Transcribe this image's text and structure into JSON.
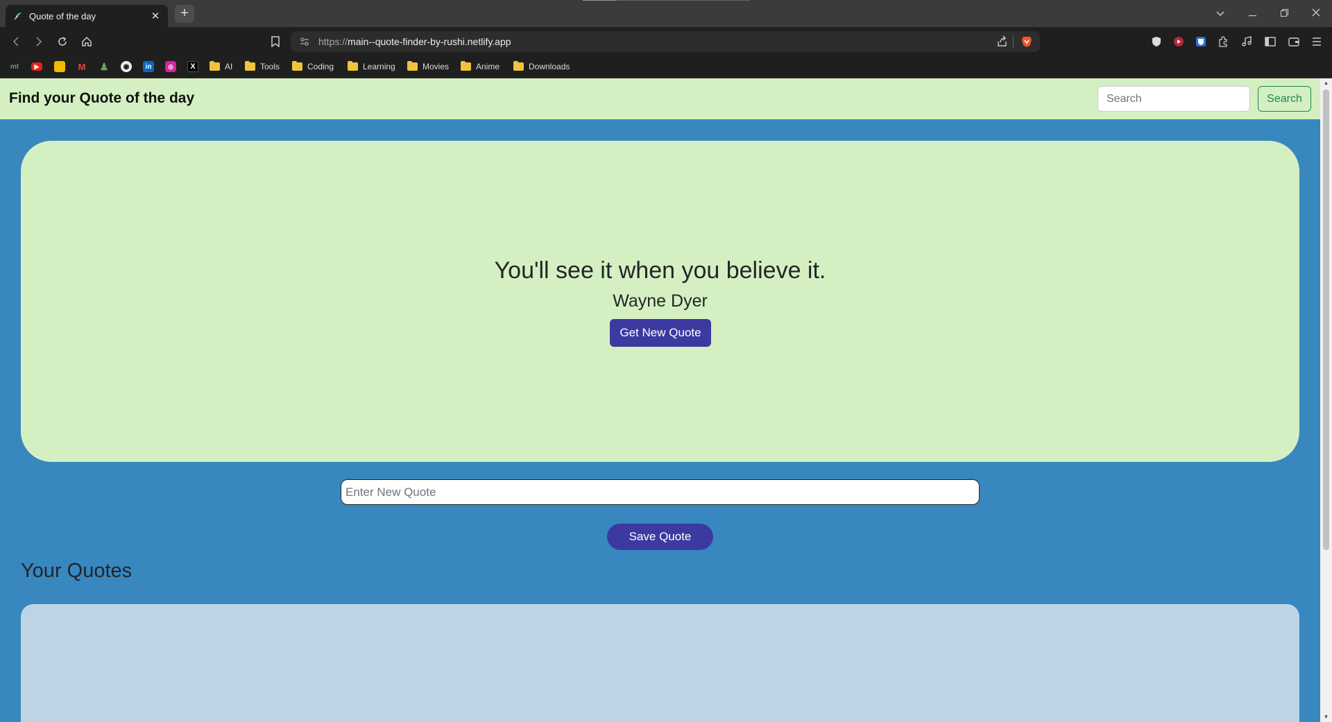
{
  "browser": {
    "tab_title": "Quote of the day",
    "url_protocol": "https://",
    "url_host": "main--quote-finder-by-rushi.netlify.app",
    "bookmarks": [
      {
        "label": "",
        "icon": "mt-icon"
      },
      {
        "label": "",
        "icon": "youtube-icon"
      },
      {
        "label": "",
        "icon": "keep-icon"
      },
      {
        "label": "",
        "icon": "gmail-icon"
      },
      {
        "label": "",
        "icon": "chess-icon"
      },
      {
        "label": "",
        "icon": "github-icon"
      },
      {
        "label": "",
        "icon": "linkedin-icon"
      },
      {
        "label": "",
        "icon": "instagram-icon"
      },
      {
        "label": "",
        "icon": "x-icon"
      },
      {
        "label": "AI",
        "icon": "folder-icon"
      },
      {
        "label": "Tools",
        "icon": "folder-icon"
      },
      {
        "label": "Coding",
        "icon": "folder-icon"
      },
      {
        "label": "Learning",
        "icon": "folder-icon"
      },
      {
        "label": "Movies",
        "icon": "folder-icon"
      },
      {
        "label": "Anime",
        "icon": "folder-icon"
      },
      {
        "label": "Downloads",
        "icon": "folder-icon"
      }
    ]
  },
  "header": {
    "brand": "Find your Quote of the day",
    "search_placeholder": "Search",
    "search_button": "Search"
  },
  "quote": {
    "text": "You'll see it when you believe it.",
    "author": "Wayne Dyer",
    "new_quote_button": "Get New Quote"
  },
  "editor": {
    "placeholder": "Enter New Quote",
    "save_button": "Save Quote"
  },
  "saved": {
    "heading": "Your Quotes"
  },
  "colors": {
    "page_bg": "#3887bf",
    "card_bg": "#d4f0c2",
    "button_bg": "#3a3aa0",
    "search_button": "#198754",
    "panel_bg": "#bcd4e4"
  }
}
